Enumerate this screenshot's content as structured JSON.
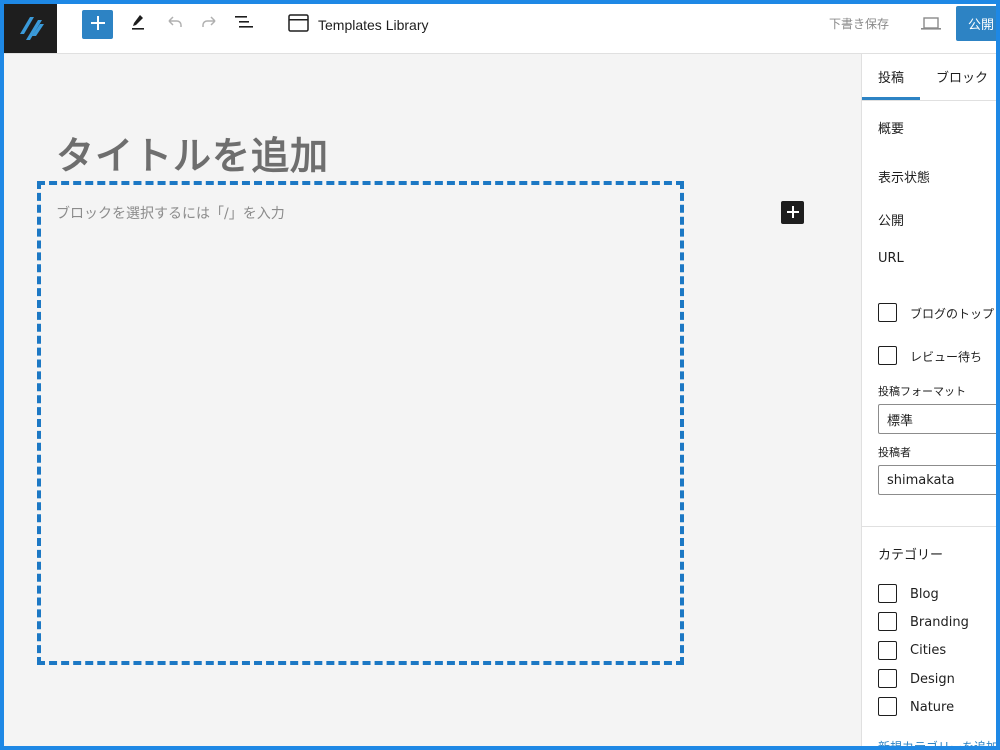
{
  "header": {
    "document_title": "Templates Library",
    "save_draft_label": "下書き保存",
    "publish_label": "公開"
  },
  "editor": {
    "title_placeholder": "タイトルを追加",
    "block_placeholder": "ブロックを選択するには「/」を入力"
  },
  "sidebar": {
    "tabs": [
      {
        "label": "投稿"
      },
      {
        "label": "ブロック"
      }
    ],
    "summary_heading": "概要",
    "rows": {
      "visibility": "表示状態",
      "publish": "公開",
      "url": "URL"
    },
    "checkboxes": {
      "blog_top": "ブログのトップ",
      "pending_review": "レビュー待ち"
    },
    "post_format": {
      "label": "投稿フォーマット",
      "value": "標準"
    },
    "author": {
      "label": "投稿者",
      "value": "shimakata"
    },
    "categories": {
      "heading": "カテゴリー",
      "items": [
        {
          "label": "Blog"
        },
        {
          "label": "Branding"
        },
        {
          "label": "Cities"
        },
        {
          "label": "Design"
        },
        {
          "label": "Nature"
        }
      ],
      "add_new_link": "新規カテゴリーを追加"
    }
  },
  "colors": {
    "accent": "#2d83c4",
    "frame": "#1e88e5",
    "block_outline": "#1c78c4",
    "canvas_bg": "#f4f4f4"
  },
  "icons": [
    "site-logo-icon",
    "plus-icon",
    "pen-icon",
    "undo-icon",
    "redo-icon",
    "list-view-icon",
    "browser-window-icon",
    "desktop-preview-icon",
    "inserter-plus-icon"
  ]
}
